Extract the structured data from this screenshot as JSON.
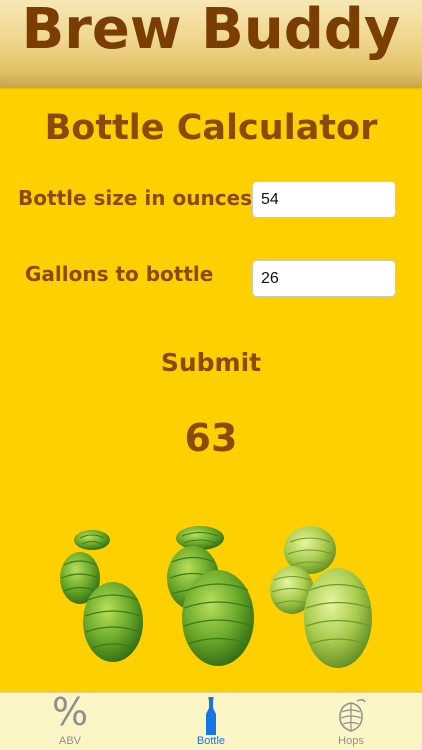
{
  "app": {
    "title": "Brew Buddy"
  },
  "calculator": {
    "title": "Bottle Calculator",
    "bottle_size_label": "Bottle size in ounces",
    "bottle_size_value": "54",
    "gallons_label": "Gallons to bottle",
    "gallons_value": "26",
    "submit_label": "Submit",
    "result": "63"
  },
  "tabbar": {
    "tabs": [
      {
        "label": "ABV",
        "icon": "percent-icon",
        "selected": false
      },
      {
        "label": "Bottle",
        "icon": "bottle-icon",
        "selected": true
      },
      {
        "label": "Hops",
        "icon": "hop-icon",
        "selected": false
      }
    ]
  },
  "colors": {
    "background": "#FFD000",
    "text_brown": "#8a4a08",
    "banner_text": "#7a3e05",
    "tab_active": "#1576e8",
    "tab_inactive": "#8f8f8f",
    "tabbar_bg": "#fcf6c6"
  }
}
